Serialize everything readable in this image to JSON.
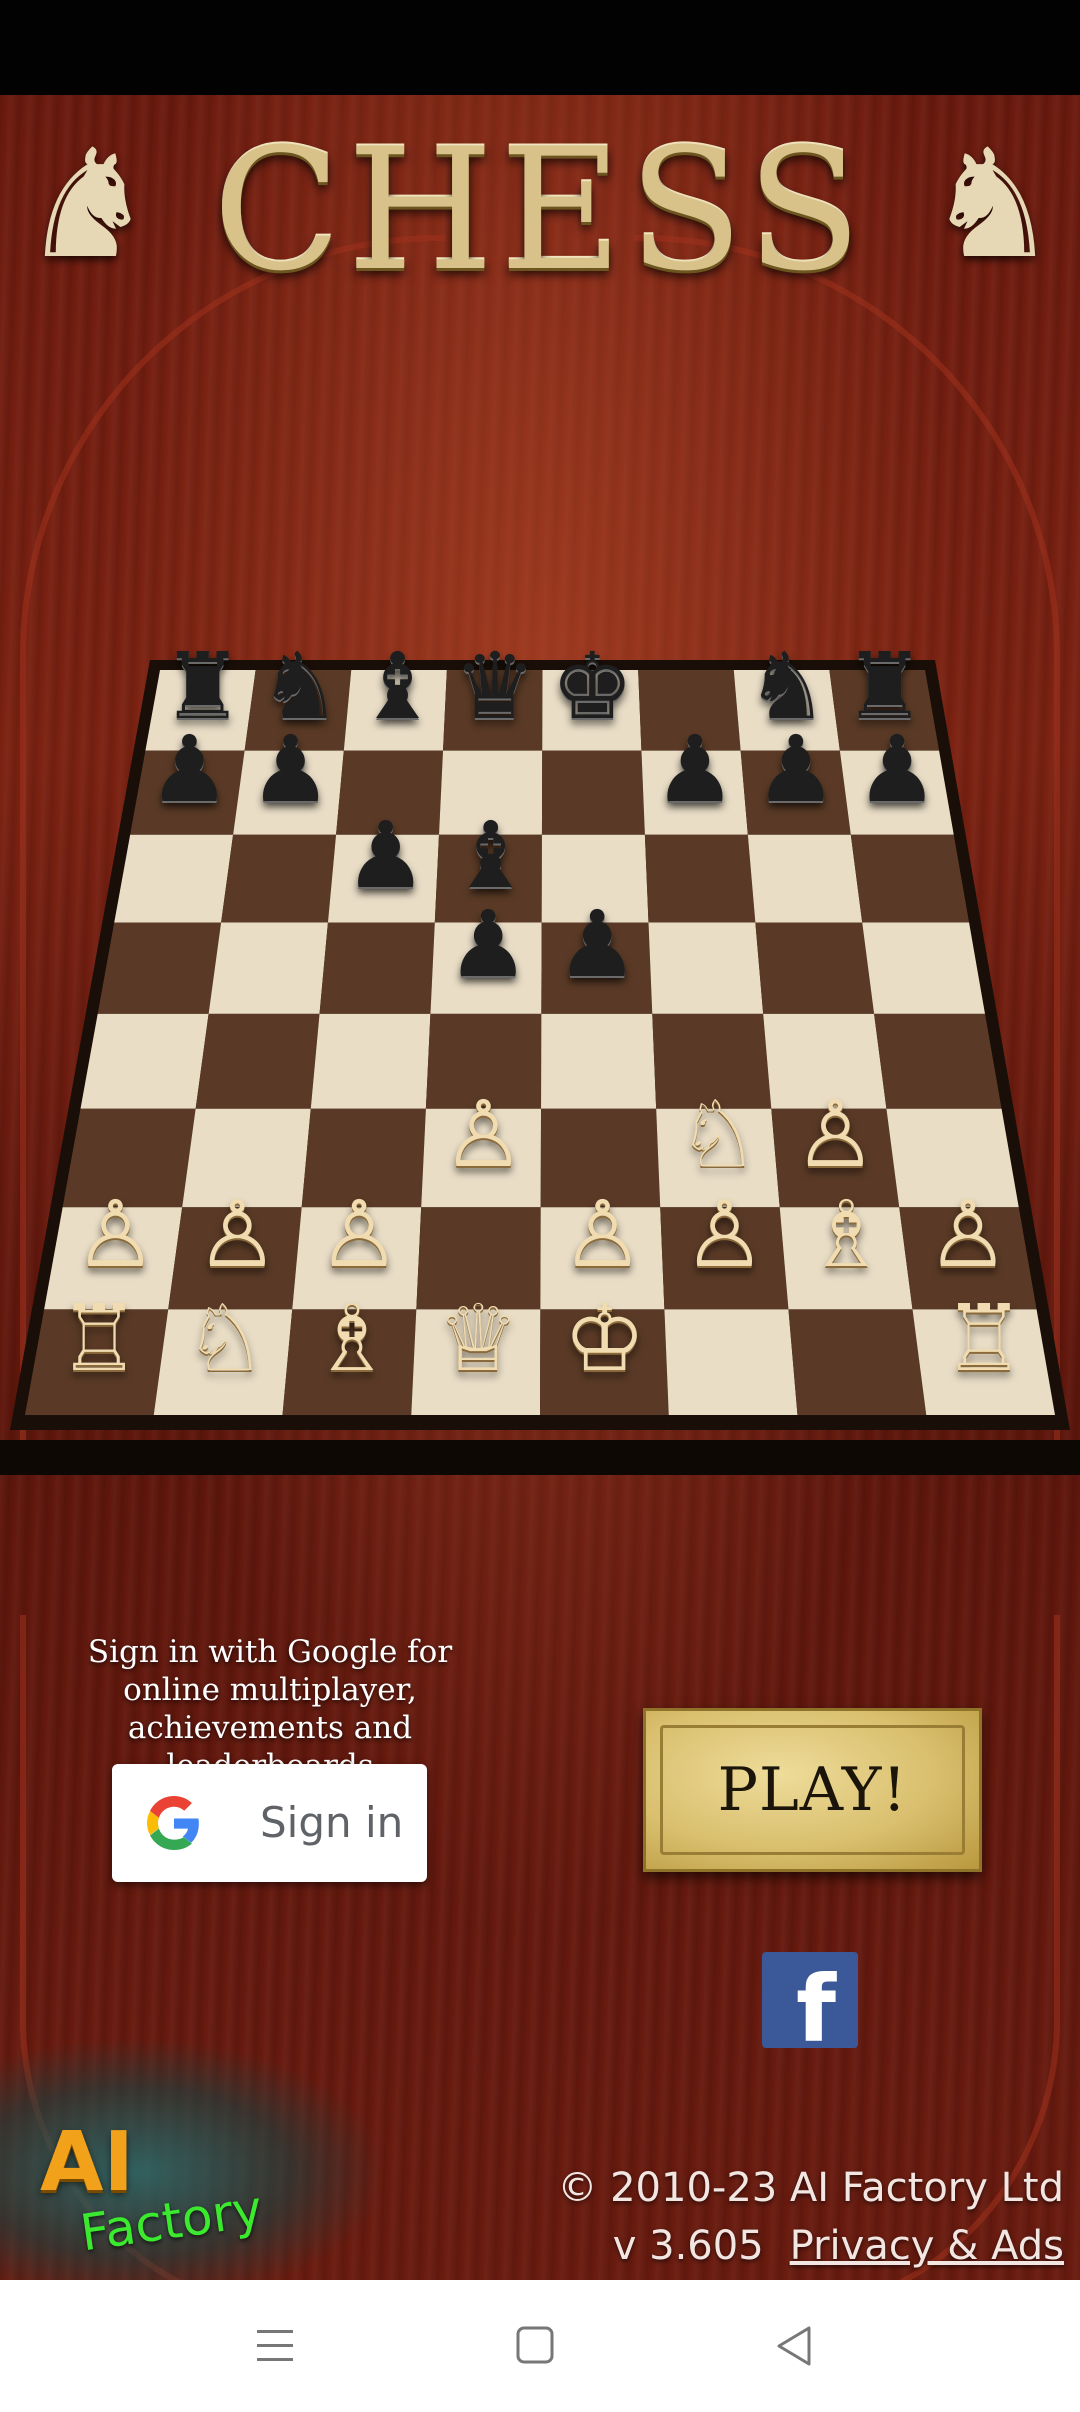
{
  "app": {
    "title": "CHESS"
  },
  "signin": {
    "prompt": "Sign in with Google for online multiplayer, achievements and leaderboards",
    "button_label": "Sign in"
  },
  "play": {
    "label": "PLAY!"
  },
  "footer": {
    "copyright": "© 2010-23 AI Factory Ltd",
    "version": "v 3.605",
    "privacy_link": "Privacy & Ads"
  },
  "logo": {
    "line1": "AI",
    "line2": "Factory"
  },
  "board": {
    "rows": [
      [
        "♜",
        "♞",
        "♝",
        "♛",
        "♚",
        "",
        "♞",
        "♜"
      ],
      [
        "♟",
        "♟",
        "",
        "",
        "",
        "♟",
        "♟",
        "♟"
      ],
      [
        "",
        "",
        "♟",
        "♝",
        "",
        "",
        "",
        ""
      ],
      [
        "",
        "",
        "",
        "♟",
        "♟",
        "",
        "",
        ""
      ],
      [
        "",
        "",
        "",
        "",
        "",
        "",
        "",
        ""
      ],
      [
        "",
        "",
        "",
        "♙",
        "",
        "♘",
        "♙",
        ""
      ],
      [
        "♙",
        "♙",
        "♙",
        "",
        "♙",
        "♙",
        "♗",
        "♙"
      ],
      [
        "♖",
        "♘",
        "♗",
        "♕",
        "♔",
        "",
        "",
        "♖"
      ]
    ],
    "colors": {
      "light_square": "#e9ddc6",
      "dark_square": "#5a3a26",
      "frame": "#1a0f08"
    }
  },
  "icons": {
    "google": "google-g-icon",
    "facebook": "facebook-f-icon",
    "nav_menu": "menu-icon",
    "nav_home": "home-square-icon",
    "nav_back": "back-triangle-icon"
  },
  "colors": {
    "background": "#6b1a0e",
    "title_gold": "#d8c28a",
    "play_button": "#d9bf6e",
    "facebook_blue": "#3b5998",
    "google_button_text": "#5f6368"
  }
}
